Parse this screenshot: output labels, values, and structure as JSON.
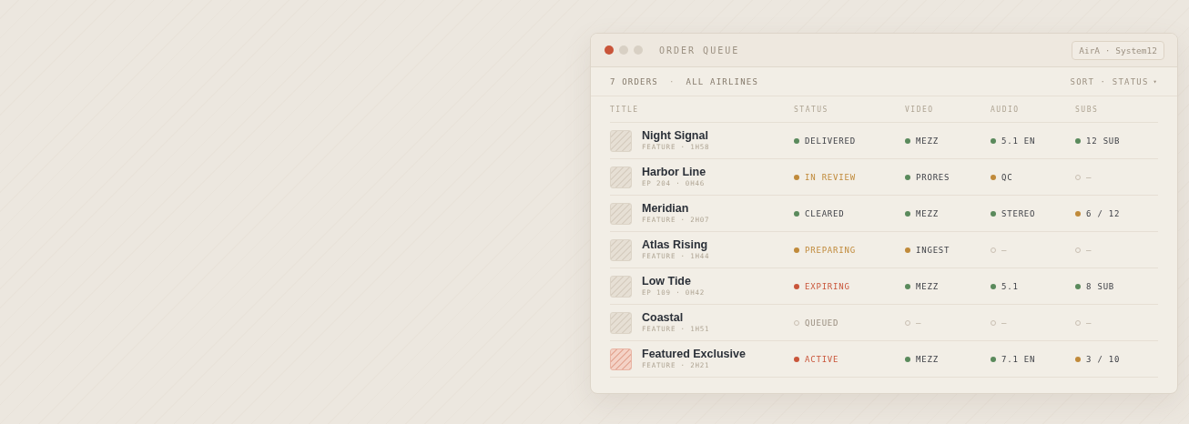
{
  "window": {
    "title": "ORDER QUEUE",
    "badge": "AirA · System12"
  },
  "toolbar": {
    "count": "7 ORDERS",
    "separator": "·",
    "filter": "ALL AIRLINES",
    "sort": "SORT · STATUS",
    "sort_caret": "▾"
  },
  "table": {
    "columns": [
      "TITLE",
      "STATUS",
      "VIDEO",
      "AUDIO",
      "SUBS"
    ],
    "rows": [
      {
        "title": "Night Signal",
        "meta": "FEATURE · 1H58",
        "highlighted": false,
        "status": {
          "text": "DELIVERED",
          "color": "#5a8a5c",
          "kind": "filled",
          "tinted": false
        },
        "video": {
          "text": "MEZZ",
          "color": "#5a8a5c",
          "kind": "filled"
        },
        "audio": {
          "text": "5.1 EN",
          "color": "#5a8a5c",
          "kind": "filled"
        },
        "subs": {
          "text": "12 SUB",
          "color": "#5a8a5c",
          "kind": "filled"
        }
      },
      {
        "title": "Harbor Line",
        "meta": "EP 204 · 0H46",
        "highlighted": false,
        "status": {
          "text": "IN REVIEW",
          "color": "#c08a3a",
          "kind": "filled",
          "tinted": true
        },
        "video": {
          "text": "PRORES",
          "color": "#5a8a5c",
          "kind": "filled"
        },
        "audio": {
          "text": "QC",
          "color": "#c08a3a",
          "kind": "filled"
        },
        "subs": {
          "text": "—",
          "color": "#c9bfb2",
          "kind": "hollow"
        }
      },
      {
        "title": "Meridian",
        "meta": "FEATURE · 2H07",
        "highlighted": false,
        "status": {
          "text": "CLEARED",
          "color": "#5a8a5c",
          "kind": "filled",
          "tinted": false
        },
        "video": {
          "text": "MEZZ",
          "color": "#5a8a5c",
          "kind": "filled"
        },
        "audio": {
          "text": "STEREO",
          "color": "#5a8a5c",
          "kind": "filled"
        },
        "subs": {
          "text": "6 / 12",
          "color": "#c08a3a",
          "kind": "filled"
        }
      },
      {
        "title": "Atlas Rising",
        "meta": "FEATURE · 1H44",
        "highlighted": false,
        "status": {
          "text": "PREPARING",
          "color": "#c08a3a",
          "kind": "filled",
          "tinted": true
        },
        "video": {
          "text": "INGEST",
          "color": "#c08a3a",
          "kind": "filled"
        },
        "audio": {
          "text": "—",
          "color": "#c9bfb2",
          "kind": "hollow"
        },
        "subs": {
          "text": "—",
          "color": "#c9bfb2",
          "kind": "hollow"
        }
      },
      {
        "title": "Low Tide",
        "meta": "EP 109 · 0H42",
        "highlighted": false,
        "status": {
          "text": "EXPIRING",
          "color": "#c9553a",
          "kind": "filled",
          "tinted": true
        },
        "video": {
          "text": "MEZZ",
          "color": "#5a8a5c",
          "kind": "filled"
        },
        "audio": {
          "text": "5.1",
          "color": "#5a8a5c",
          "kind": "filled"
        },
        "subs": {
          "text": "8 SUB",
          "color": "#5a8a5c",
          "kind": "filled"
        }
      },
      {
        "title": "Coastal",
        "meta": "FEATURE · 1H51",
        "highlighted": false,
        "status": {
          "text": "QUEUED",
          "color": "#c9bfb2",
          "kind": "hollow",
          "tinted": true
        },
        "video": {
          "text": "—",
          "color": "#c9bfb2",
          "kind": "hollow"
        },
        "audio": {
          "text": "—",
          "color": "#c9bfb2",
          "kind": "hollow"
        },
        "subs": {
          "text": "—",
          "color": "#c9bfb2",
          "kind": "hollow"
        }
      },
      {
        "title": "Featured Exclusive",
        "meta": "FEATURE · 2H21",
        "highlighted": true,
        "status": {
          "text": "ACTIVE",
          "color": "#c9553a",
          "kind": "filled",
          "tinted": true
        },
        "video": {
          "text": "MEZZ",
          "color": "#5a8a5c",
          "kind": "filled"
        },
        "audio": {
          "text": "7.1 EN",
          "color": "#5a8a5c",
          "kind": "filled"
        },
        "subs": {
          "text": "3 / 10",
          "color": "#c08a3a",
          "kind": "filled"
        }
      }
    ]
  }
}
